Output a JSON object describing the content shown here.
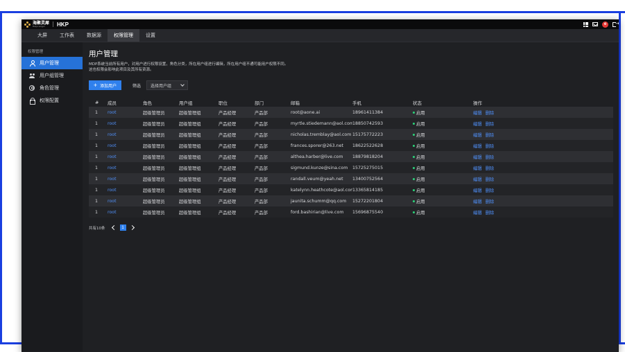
{
  "brand": {
    "logo_cn": "海聚灵犀",
    "logo_en": "Haiju Lingxi",
    "app_name": "HKP"
  },
  "nav": {
    "tabs": [
      {
        "label": "大屏"
      },
      {
        "label": "工作表"
      },
      {
        "label": "数据源"
      },
      {
        "label": "权限管理",
        "active": true
      },
      {
        "label": "设置"
      }
    ]
  },
  "sidebar": {
    "group_label": "权限管理",
    "items": [
      {
        "label": "用户管理",
        "icon": "user-icon",
        "active": true
      },
      {
        "label": "用户组管理",
        "icon": "user-group-icon"
      },
      {
        "label": "角色管理",
        "icon": "role-icon"
      },
      {
        "label": "权限配置",
        "icon": "lock-icon"
      }
    ]
  },
  "page": {
    "title": "用户管理",
    "desc_line1": "MDP系统当前所有用户，对用户进行权限设置，角色分类，所在用户组进行编辑，所在用户组不通可能用户权限不同。",
    "desc_line2": "这也权限会影响此项目及其所有资源。"
  },
  "toolbar": {
    "add_label": "添加用户",
    "filter_label": "筛选",
    "filter_placeholder": "选择用户组"
  },
  "table": {
    "headers": [
      "#",
      "成员",
      "角色",
      "用户组",
      "职位",
      "部门",
      "邮箱",
      "手机",
      "状态",
      "操作"
    ],
    "rows": [
      [
        "1",
        "root",
        "超级管理员",
        "超级管理组",
        "产品经理",
        "产品部",
        "root@aone.ai",
        "18961411384",
        "启用"
      ],
      [
        "1",
        "root",
        "超级管理员",
        "超级管理组",
        "产品经理",
        "产品部",
        "myrtle.stiedemann@aol.com",
        "18850742593",
        "启用"
      ],
      [
        "1",
        "root",
        "超级管理员",
        "超级管理组",
        "产品经理",
        "产品部",
        "nicholas.tremblay@aol.com",
        "15175772223",
        "启用"
      ],
      [
        "1",
        "root",
        "超级管理员",
        "超级管理组",
        "产品经理",
        "产品部",
        "frances.sporer@263.net",
        "18622522628",
        "启用"
      ],
      [
        "1",
        "root",
        "超级管理员",
        "超级管理组",
        "产品经理",
        "产品部",
        "althea.harber@live.com",
        "18879818204",
        "启用"
      ],
      [
        "1",
        "root",
        "超级管理员",
        "超级管理组",
        "产品经理",
        "产品部",
        "sigmund.kunze@sina.com",
        "15725275015",
        "启用"
      ],
      [
        "1",
        "root",
        "超级管理员",
        "超级管理组",
        "产品经理",
        "产品部",
        "randall.veum@yeah.net",
        "13400752564",
        "启用"
      ],
      [
        "1",
        "root",
        "超级管理员",
        "超级管理组",
        "产品经理",
        "产品部",
        "katelynn.heathcote@aol.com",
        "13365814185",
        "启用"
      ],
      [
        "1",
        "root",
        "超级管理员",
        "超级管理组",
        "产品经理",
        "产品部",
        "jaunita.schumm@qq.com",
        "15272201804",
        "启用"
      ],
      [
        "1",
        "root",
        "超级管理员",
        "超级管理组",
        "产品经理",
        "产品部",
        "ford.bashirian@live.com",
        "15696875540",
        "启用"
      ]
    ],
    "edit_label": "编辑",
    "delete_label": "删除",
    "status_color": "#2bd37a"
  },
  "pagination": {
    "total_text": "共有10条",
    "current_page": "1"
  },
  "colors": {
    "accent": "#2f80ed",
    "frame": "#1a3fe0",
    "link": "#4f8ff7"
  }
}
